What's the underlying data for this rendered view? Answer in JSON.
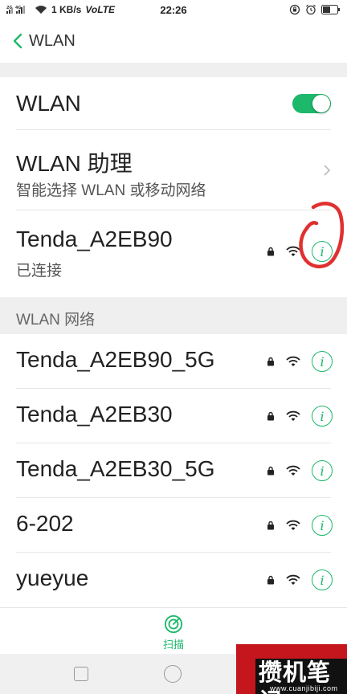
{
  "status_bar": {
    "signal_text": "2G|4G",
    "speed": "1 KB/s",
    "network": "VoLTE",
    "time": "22:26"
  },
  "header": {
    "back_label": "WLAN"
  },
  "wlan_toggle": {
    "label": "WLAN",
    "state": "on"
  },
  "assistant": {
    "title": "WLAN 助理",
    "subtitle": "智能选择 WLAN 或移动网络"
  },
  "connected": {
    "ssid": "Tenda_A2EB90",
    "status": "已连接"
  },
  "section": {
    "label": "WLAN 网络"
  },
  "networks": [
    {
      "ssid": "Tenda_A2EB90_5G"
    },
    {
      "ssid": "Tenda_A2EB30"
    },
    {
      "ssid": "Tenda_A2EB30_5G"
    },
    {
      "ssid": "6-202"
    },
    {
      "ssid": "yueyue"
    }
  ],
  "scan": {
    "label": "扫描"
  },
  "watermark": {
    "brand": "攒机笔记",
    "url": "www.cuanjibiji.com"
  },
  "colors": {
    "accent": "#1db86c",
    "annotation": "#e03030",
    "watermark_red": "#c4161c"
  },
  "icons": [
    "back-chevron-icon",
    "wifi-icon",
    "lock-icon",
    "info-icon",
    "chevron-right-icon",
    "scan-icon",
    "alarm-icon",
    "battery-icon"
  ]
}
